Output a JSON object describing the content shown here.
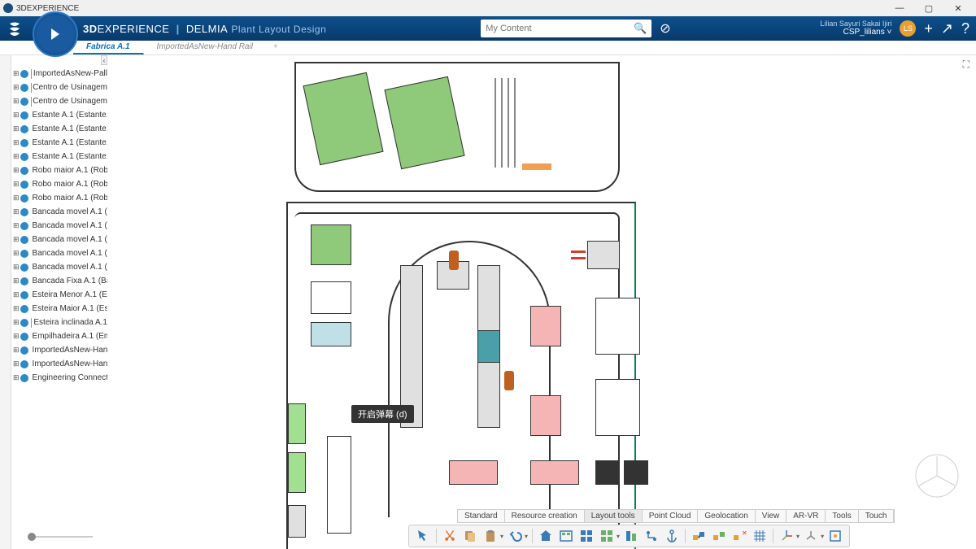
{
  "titlebar": {
    "title": "3DEXPERIENCE"
  },
  "topbar": {
    "brand_bold": "3D",
    "brand_rest": "EXPERIENCE",
    "brand_sep": "|",
    "brand_product": "DELMIA",
    "brand_app": "Plant Layout Design",
    "search_placeholder": "My Content",
    "user_fullname": "Lilian Sayuri Sakai Ijiri",
    "user_role": "CSP_lilians",
    "avatar_initials": "LS"
  },
  "tabs": {
    "active": "Fabrica A.1",
    "inactive": "ImportedAsNew-Hand Rail"
  },
  "tree": [
    "ImportedAsNew-Pall",
    "Centro de Usinagem",
    "Centro de Usinagem",
    "Estante A.1 (Estante.",
    "Estante A.1 (Estante.",
    "Estante A.1 (Estante.",
    "Estante A.1 (Estante.",
    "Robo maior A.1 (Rob",
    "Robo maior A.1 (Rob",
    "Robo maior A.1 (Rob",
    "Bancada movel A.1 (I",
    "Bancada movel A.1 (I",
    "Bancada movel A.1 (I",
    "Bancada movel A.1 (I",
    "Bancada movel A.1 (I",
    "Bancada Fixa A.1 (Ba",
    "Esteira Menor A.1 (E:",
    "Esteira Maior A.1 (Es",
    "Esteira inclinada A.1",
    "Empilhadeira A.1 (Em",
    "ImportedAsNew-Han",
    "ImportedAsNew-Han",
    "Engineering Connect"
  ],
  "tooltip": "开启弹幕 (d)",
  "bottom_tabs": [
    "Standard",
    "Resource creation",
    "Layout tools",
    "Point Cloud",
    "Geolocation",
    "View",
    "AR-VR",
    "Tools",
    "Touch"
  ],
  "bottom_tabs_active": 2,
  "toolbar_icons": [
    "arrow",
    "scissors",
    "copy",
    "paste",
    "undo",
    "redo",
    "home",
    "layout1",
    "grid1",
    "grid2",
    "align",
    "flow",
    "anchor",
    "assem1",
    "assem2",
    "assem3",
    "grid",
    "axes",
    "triad",
    "elem"
  ]
}
